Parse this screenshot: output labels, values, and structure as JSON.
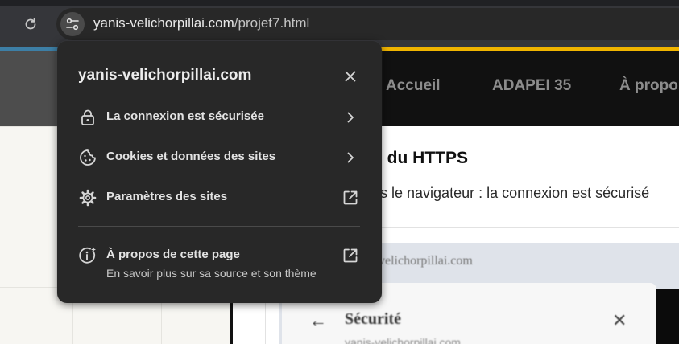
{
  "browser": {
    "url_host": "yanis-velichorpillai.com",
    "url_path": "/projet7.html"
  },
  "site_nav": {
    "items": [
      "Accueil",
      "ADAPEI 35",
      "À propos"
    ]
  },
  "article": {
    "title_fragment": "n du HTTPS",
    "text_fragment": "ns le navigateur : la connexion est sécurisé",
    "screenshot": {
      "url_text": "velichorpillai.com",
      "back_glyph": "←",
      "panel_title": "Sécurité",
      "close_glyph": "✕",
      "panel_sub": "yanis-velichorpillai.com"
    }
  },
  "site_info_popup": {
    "title": "yanis-velichorpillai.com",
    "rows": [
      {
        "label": "La connexion est sécurisée",
        "icon": "lock-icon",
        "trail": "chevron-right-icon"
      },
      {
        "label": "Cookies et données des sites",
        "icon": "cookie-icon",
        "trail": "chevron-right-icon"
      },
      {
        "label": "Paramètres des sites",
        "icon": "gear-icon",
        "trail": "open-external-icon"
      },
      {
        "label": "À propos de cette page",
        "sublabel": "En savoir plus sur sa source et son thème",
        "icon": "page-info-icon",
        "trail": "open-external-icon"
      }
    ]
  },
  "colors": {
    "popup_bg": "#282828",
    "toolbar_bg": "#35363a",
    "site_accent_yellow": "#f0b400",
    "site_accent_blue": "#3d7fa6"
  }
}
